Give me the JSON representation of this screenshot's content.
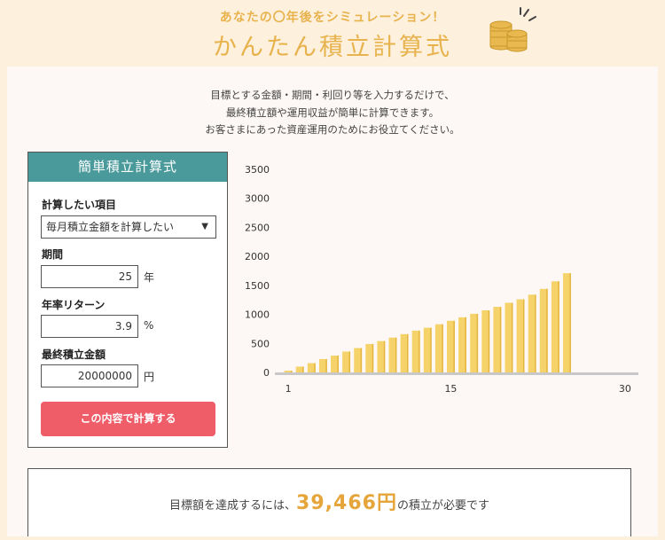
{
  "header": {
    "subtitle": "あなたの〇年後をシミュレーション！",
    "title": "かんたん積立計算式"
  },
  "intro": {
    "lines": [
      "目標とする金額・期間・利回り等を入力するだけで、",
      "最終積立額や運用収益が簡単に計算できます。",
      "お客さまにあった資産運用のためにお役立てください。"
    ]
  },
  "calculator": {
    "title": "簡単積立計算式",
    "target_label": "計算したい項目",
    "target_value": "毎月積立金額を計算したい",
    "period_label": "期間",
    "period_value": "25",
    "period_unit": "年",
    "return_label": "年率リターン",
    "return_value": "3.9",
    "return_unit": "%",
    "final_label": "最終積立金額",
    "final_value": "20000000",
    "final_unit": "円",
    "button_label": "この内容で計算する"
  },
  "chart_data": {
    "type": "bar",
    "x_ticks": [
      "1",
      "15",
      "30"
    ],
    "y_ticks": [
      "0",
      "500",
      "1000",
      "1500",
      "2000",
      "2500",
      "3000",
      "3500"
    ],
    "ylim": [
      0,
      3500
    ],
    "xlim": [
      0,
      31
    ],
    "grid": false,
    "bar_color": "#f6d36a",
    "x": [
      1,
      2,
      3,
      4,
      5,
      6,
      7,
      8,
      9,
      10,
      11,
      12,
      13,
      14,
      15,
      16,
      17,
      18,
      19,
      20,
      21,
      22,
      23,
      24,
      25
    ],
    "values": [
      30,
      100,
      160,
      230,
      290,
      360,
      420,
      490,
      540,
      600,
      660,
      720,
      770,
      830,
      890,
      950,
      1010,
      1070,
      1130,
      1200,
      1260,
      1340,
      1440,
      1570,
      1710
    ]
  },
  "result": {
    "prefix": "目標額を達成するには、",
    "amount": "39,466円",
    "suffix": "の積立が必要です"
  }
}
